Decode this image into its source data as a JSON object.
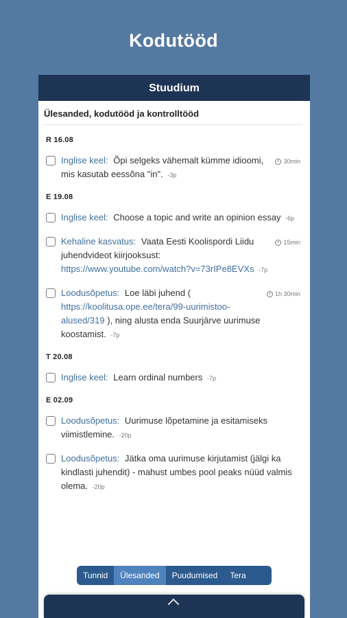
{
  "page_title": "Kodutööd",
  "app": {
    "header_title": "Stuudium",
    "section_title": "Ülesanded, kodutööd ja kontrolltööd"
  },
  "groups": [
    {
      "date": "R 16.08",
      "tasks": [
        {
          "subject": "Inglise keel:",
          "text": "Õpi selgeks vähemalt kümme idioomi, mis kasutab eessõna \"in\".",
          "points": "-3p",
          "duration": "30min"
        }
      ]
    },
    {
      "date": "E 19.08",
      "tasks": [
        {
          "subject": "Inglise keel:",
          "text": "Choose a topic and write an opinion essay",
          "points": "-6p"
        },
        {
          "subject": "Kehaline kasvatus:",
          "text": "Vaata Eesti Koolispordi Liidu juhendvideot kiirjooksust:",
          "link": "https://www.youtube.com/watch?v=73rIPe8EVXs",
          "points": "-7p",
          "duration": "15min"
        },
        {
          "subject": "Loodusõpetus:",
          "text": "Loe läbi juhend (",
          "link": "https://koolitusa.ope.ee/tera/99-uurimistoo-alused/319",
          "text_after": "), ning alusta enda Suurjärve uurimuse koostamist.",
          "points": "-7p",
          "duration": "1h 30min"
        }
      ]
    },
    {
      "date": "T 20.08",
      "tasks": [
        {
          "subject": "Inglise keel:",
          "text": "Learn ordinal numbers",
          "points": "-7p"
        }
      ]
    },
    {
      "date": "E 02.09",
      "tasks": [
        {
          "subject": "Loodusõpetus:",
          "text": "Uurimuse lõpetamine ja esitamiseks viimistlemine.",
          "points": "-20p"
        },
        {
          "subject": "Loodusõpetus:",
          "text": "Jätka oma uurimuse kirjutamist (jälgi ka kindlasti juhendit) - mahust umbes pool peaks nüüd valmis olema.",
          "points": "-20p"
        }
      ]
    }
  ],
  "tabs": [
    {
      "label": "Tunnid"
    },
    {
      "label": "Ülesanded",
      "active": true
    },
    {
      "label": "Puudumised"
    },
    {
      "label": "Tera"
    }
  ]
}
